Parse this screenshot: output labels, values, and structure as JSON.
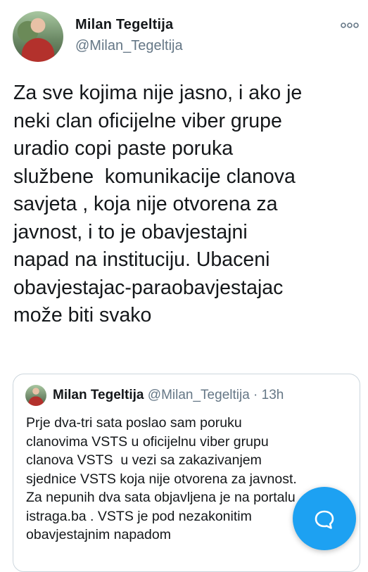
{
  "tweet": {
    "author": {
      "name": "Milan Tegeltija",
      "handle": "@Milan_Tegeltija"
    },
    "text": "Za sve kojima nije jasno, i ako je\nneki clan oficijelne viber grupe\nuradio copi paste poruka\nslužbene  komunikacije clanova\nsavjeta , koja nije otvorena za\njavnost, i to je obavjestajni\nnapad na instituciju. Ubaceni\nobavjestajac-paraobavjestajac\nmože biti svako"
  },
  "quoted_tweet": {
    "author": {
      "name": "Milan Tegeltija",
      "handle": "@Milan_Tegeltija"
    },
    "separator": "·",
    "time": "13h",
    "text": "Prje dva-tri sata poslao sam poruku\nclanovima VSTS u oficijelnu viber grupu\nclanova VSTS  u vezi sa zakazivanjem\nsjednice VSTS koja nije otvorena za javnost.\nZa nepunih dva sata objavljena je na portalu\nistraga.ba . VSTS je pod nezakonitim\nobavjestajnim napadom"
  },
  "icons": {
    "more": "more-icon",
    "compose": "compose-message-icon"
  },
  "colors": {
    "accent": "#1da1f2",
    "secondary_text": "#657786",
    "border": "#ccd6dd"
  }
}
